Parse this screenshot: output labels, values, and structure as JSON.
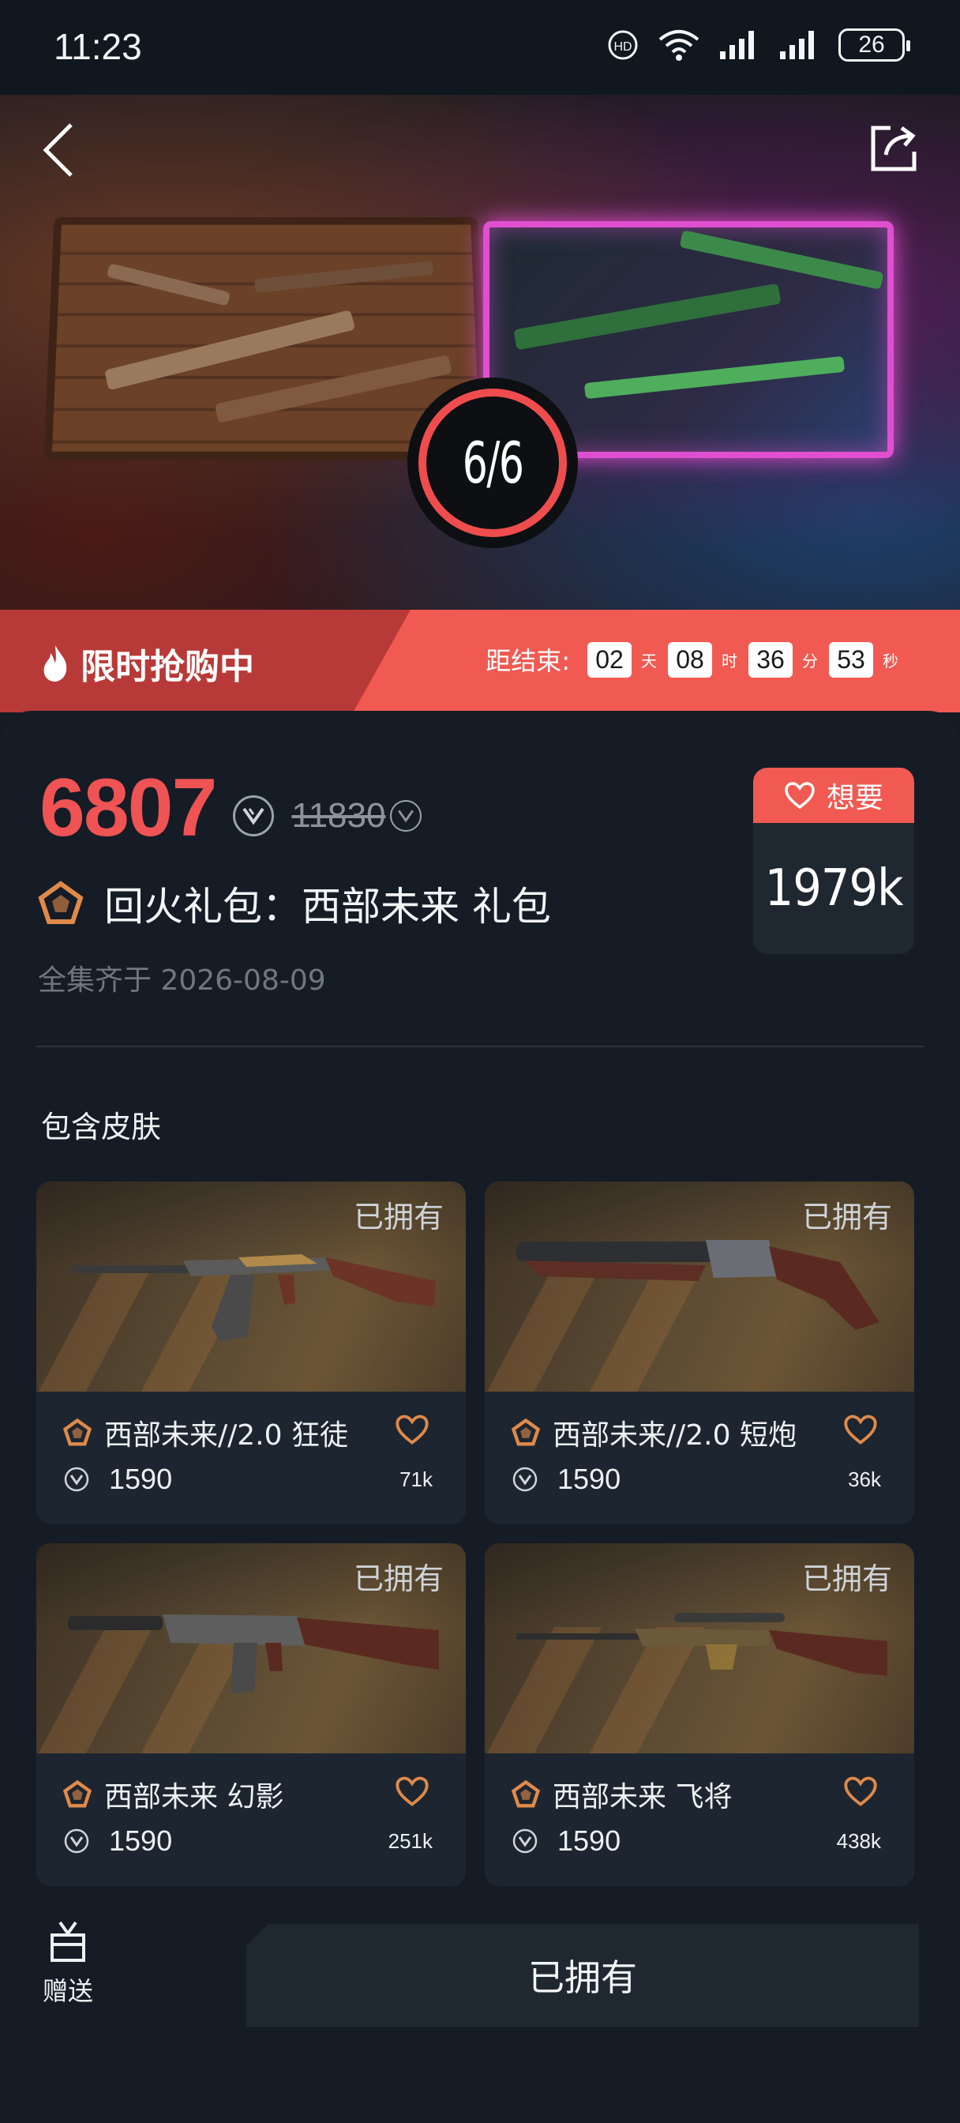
{
  "status_bar": {
    "time": "11:23",
    "battery": "26"
  },
  "hero": {
    "progress": "6/6",
    "progress_fraction": 1.0
  },
  "promo": {
    "title": "限时抢购中",
    "countdown_label": "距结束:",
    "days": "02",
    "days_unit": "天",
    "hours": "08",
    "hours_unit": "时",
    "minutes": "36",
    "minutes_unit": "分",
    "seconds": "53",
    "seconds_unit": "秒"
  },
  "bundle": {
    "price": "6807",
    "original_price": "11830",
    "name": "回火礼包：西部未来 礼包",
    "collected_date": "全集齐于 2026-08-09",
    "want_label": "想要",
    "want_count": "1979k"
  },
  "section": {
    "title": "包含皮肤"
  },
  "skins": [
    {
      "owned": "已拥有",
      "name": "西部未来//2.0 狂徒",
      "price": "1590",
      "likes": "71k"
    },
    {
      "owned": "已拥有",
      "name": "西部未来//2.0 短炮",
      "price": "1590",
      "likes": "36k"
    },
    {
      "owned": "已拥有",
      "name": "西部未来 幻影",
      "price": "1590",
      "likes": "251k"
    },
    {
      "owned": "已拥有",
      "name": "西部未来 飞将",
      "price": "1590",
      "likes": "438k"
    }
  ],
  "bottom": {
    "gift_label": "赠送",
    "action_label": "已拥有"
  },
  "colors": {
    "accent": "#f05a52",
    "background": "#141b23",
    "card": "#1d2630",
    "tier_icon": "#e08a4a"
  },
  "icons": [
    "back-icon",
    "share-icon",
    "flame-icon",
    "vp-currency-icon",
    "tier-icon",
    "heart-icon",
    "gift-icon",
    "wifi-icon",
    "signal-icon"
  ]
}
